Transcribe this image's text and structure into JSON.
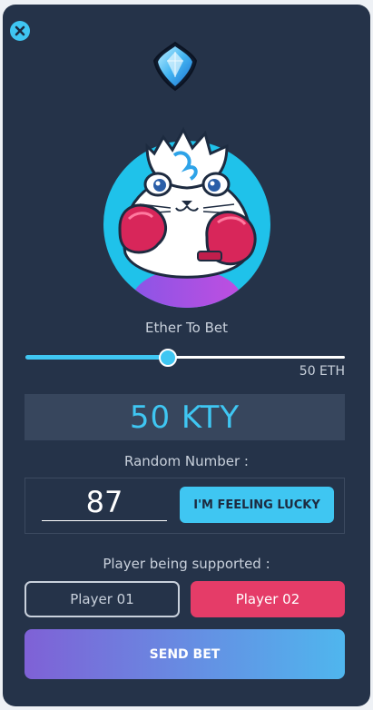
{
  "bet": {
    "slider_label": "Ether To Bet",
    "eth_value": "50 ETH",
    "slider_fraction": 0.445,
    "kty_amount": "50 KTY"
  },
  "random": {
    "label": "Random Number :",
    "value": "87",
    "lucky_button": "I'M FEELING LUCKY"
  },
  "players": {
    "label": "Player being supported :",
    "player_1": "Player 01",
    "player_2": "Player 02",
    "selected": "Player 02"
  },
  "actions": {
    "send_bet": "SEND BET"
  },
  "icons": {
    "close": "close-icon",
    "gem": "diamond-gem-icon",
    "avatar": "kitty-boxer-avatar"
  },
  "colors": {
    "accent": "#3fc6f2",
    "panel": "#253349",
    "selected_player": "#e53c68"
  }
}
